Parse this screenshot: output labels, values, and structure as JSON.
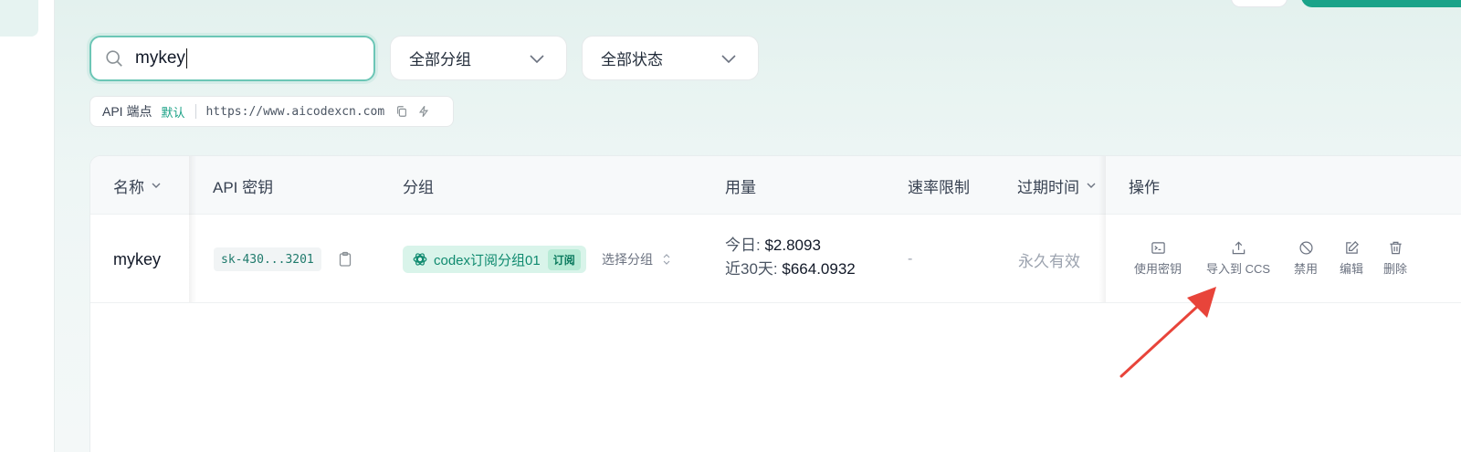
{
  "search": {
    "value": "mykey"
  },
  "filters": {
    "group": "全部分组",
    "status": "全部状态"
  },
  "api_endpoint": {
    "label": "API 端点",
    "default_tag": "默认",
    "url": "https://www.aicodexcn.com"
  },
  "table": {
    "headers": {
      "name": "名称",
      "api_key": "API 密钥",
      "group": "分组",
      "usage": "用量",
      "rate_limit": "速率限制",
      "expire": "过期时间",
      "actions": "操作"
    },
    "rows": [
      {
        "name": "mykey",
        "api_key": "sk-430...3201",
        "group": "codex订阅分组01",
        "group_tag": "订阅",
        "select_group": "选择分组",
        "usage_today_label": "今日:",
        "usage_today": "$2.8093",
        "usage_30d_label": "近30天:",
        "usage_30d": "$664.0932",
        "rate_limit": "-",
        "expire": "永久有效",
        "actions": {
          "use_key": "使用密钥",
          "import_ccs": "导入到 CCS",
          "disable": "禁用",
          "edit": "编辑",
          "delete": "删除"
        }
      }
    ]
  },
  "colors": {
    "accent": "#1aa389",
    "annotation_arrow": "#e8443a"
  }
}
